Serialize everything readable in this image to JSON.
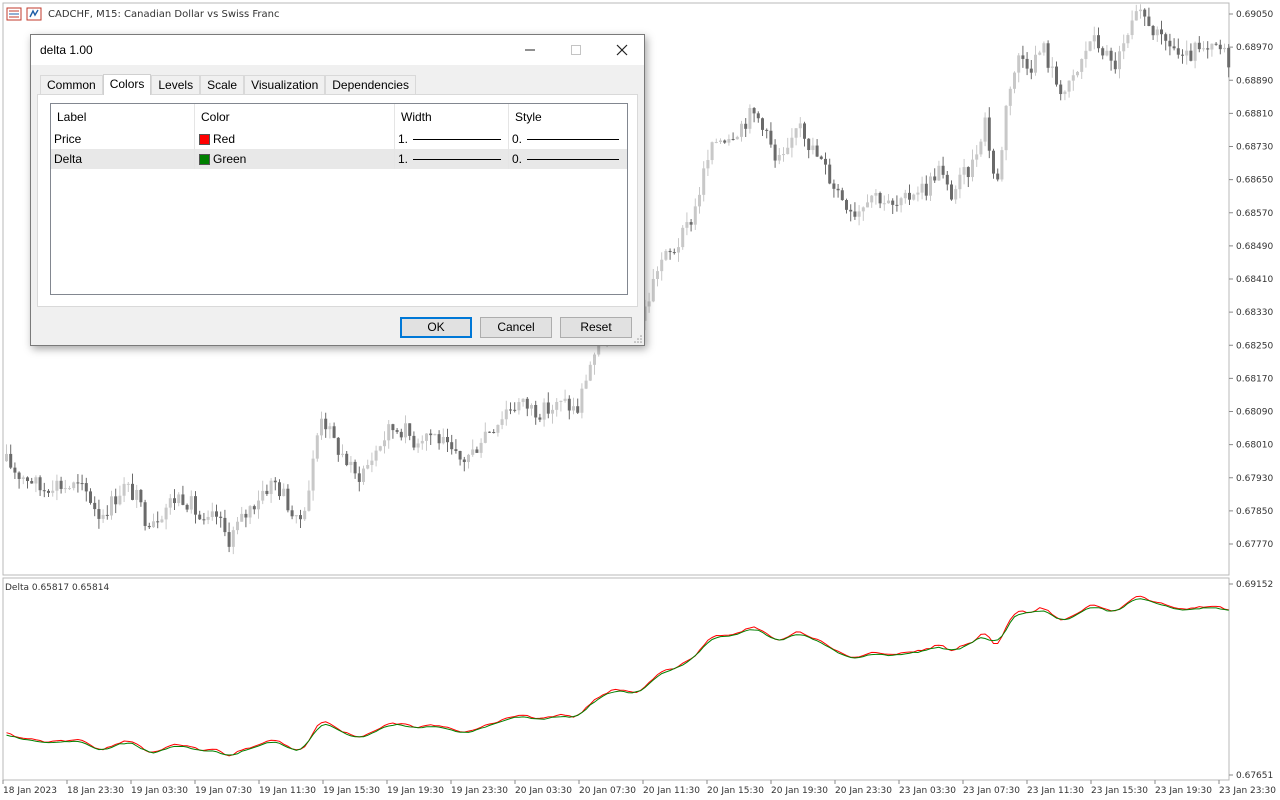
{
  "chart_window": {
    "symbol_caption": "CADCHF, M15:  Canadian Dollar vs Swiss Franc",
    "subwindow_caption": "Delta 0.65817 0.65814",
    "colors": {
      "bull": "#c8c8c8",
      "bear": "#6a6a6a",
      "price_line": "#ff0000",
      "delta_line": "#008000",
      "grid_border": "#b9b9b9"
    }
  },
  "dialog": {
    "title": "delta 1.00",
    "tabs": [
      "Common",
      "Colors",
      "Levels",
      "Scale",
      "Visualization",
      "Dependencies"
    ],
    "active_tab": "Colors",
    "grid": {
      "columns": [
        "Label",
        "Color",
        "Width",
        "Style"
      ],
      "rows": [
        {
          "label": "Price",
          "color_name": "Red",
          "color_hex": "#ff0000",
          "width": "1.",
          "style": "0."
        },
        {
          "label": "Delta",
          "color_name": "Green",
          "color_hex": "#008000",
          "width": "1.",
          "style": "0."
        }
      ]
    },
    "buttons": {
      "ok": "OK",
      "cancel": "Cancel",
      "reset": "Reset"
    }
  },
  "chart_data": [
    {
      "type": "candlestick",
      "title": "CADCHF, M15",
      "y_ticks": [
        "0.69050",
        "0.68970",
        "0.68890",
        "0.68810",
        "0.68730",
        "0.68650",
        "0.68570",
        "0.68490",
        "0.68410",
        "0.68330",
        "0.68250",
        "0.68170",
        "0.68090",
        "0.68010",
        "0.67930",
        "0.67850",
        "0.67770"
      ],
      "ylim": [
        0.6772,
        0.6908
      ],
      "x_ticks": [
        "18 Jan 2023",
        "18 Jan 23:30",
        "19 Jan 03:30",
        "19 Jan 07:30",
        "19 Jan 11:30",
        "19 Jan 15:30",
        "19 Jan 19:30",
        "19 Jan 23:30",
        "20 Jan 03:30",
        "20 Jan 07:30",
        "20 Jan 11:30",
        "20 Jan 15:30",
        "20 Jan 19:30",
        "20 Jan 23:30",
        "23 Jan 03:30",
        "23 Jan 07:30",
        "23 Jan 11:30",
        "23 Jan 15:30",
        "23 Jan 19:30",
        "23 Jan 23:30"
      ],
      "close_path": [
        [
          0,
          0.6797
        ],
        [
          1,
          0.6794
        ],
        [
          2,
          0.6793
        ],
        [
          3,
          0.679
        ],
        [
          4,
          0.6792
        ],
        [
          5,
          0.6791
        ],
        [
          6,
          0.6791
        ],
        [
          7,
          0.6789
        ],
        [
          8,
          0.6784
        ],
        [
          9,
          0.6787
        ],
        [
          10,
          0.6791
        ],
        [
          11,
          0.6789
        ],
        [
          12,
          0.6783
        ],
        [
          13,
          0.6784
        ],
        [
          14,
          0.6787
        ],
        [
          15,
          0.6789
        ],
        [
          16,
          0.6786
        ],
        [
          17,
          0.6781
        ],
        [
          18,
          0.6784
        ],
        [
          19,
          0.6778
        ],
        [
          20,
          0.6782
        ],
        [
          21,
          0.6786
        ],
        [
          22,
          0.679
        ],
        [
          23,
          0.6792
        ],
        [
          24,
          0.6788
        ],
        [
          25,
          0.6781
        ],
        [
          26,
          0.6791
        ],
        [
          27,
          0.6809
        ],
        [
          28,
          0.6802
        ],
        [
          29,
          0.6798
        ],
        [
          30,
          0.6793
        ],
        [
          31,
          0.6796
        ],
        [
          32,
          0.6801
        ],
        [
          33,
          0.6805
        ],
        [
          34,
          0.6805
        ],
        [
          35,
          0.6802
        ],
        [
          36,
          0.6804
        ],
        [
          37,
          0.6803
        ],
        [
          38,
          0.6799
        ],
        [
          39,
          0.6797
        ],
        [
          40,
          0.6799
        ],
        [
          41,
          0.6804
        ],
        [
          42,
          0.6806
        ],
        [
          43,
          0.681
        ],
        [
          44,
          0.6811
        ],
        [
          45,
          0.681
        ],
        [
          46,
          0.6809
        ],
        [
          47,
          0.681
        ],
        [
          48,
          0.6811
        ],
        [
          49,
          0.6809
        ],
        [
          50,
          0.682
        ],
        [
          51,
          0.6826
        ],
        [
          52,
          0.683
        ],
        [
          53,
          0.6831
        ],
        [
          54,
          0.6828
        ],
        [
          55,
          0.6835
        ],
        [
          56,
          0.6845
        ],
        [
          57,
          0.6847
        ],
        [
          58,
          0.6851
        ],
        [
          59,
          0.6857
        ],
        [
          60,
          0.6868
        ],
        [
          61,
          0.6875
        ],
        [
          62,
          0.6876
        ],
        [
          63,
          0.6878
        ],
        [
          64,
          0.6881
        ],
        [
          65,
          0.6879
        ],
        [
          66,
          0.6869
        ],
        [
          67,
          0.687
        ],
        [
          68,
          0.6881
        ],
        [
          69,
          0.6873
        ],
        [
          70,
          0.6869
        ],
        [
          71,
          0.6864
        ],
        [
          72,
          0.686
        ],
        [
          73,
          0.6857
        ],
        [
          74,
          0.6862
        ],
        [
          75,
          0.6861
        ],
        [
          76,
          0.6858
        ],
        [
          77,
          0.6859
        ],
        [
          78,
          0.6863
        ],
        [
          79,
          0.6863
        ],
        [
          80,
          0.6868
        ],
        [
          81,
          0.6861
        ],
        [
          82,
          0.6865
        ],
        [
          83,
          0.6869
        ],
        [
          84,
          0.688
        ],
        [
          85,
          0.6862
        ],
        [
          86,
          0.6887
        ],
        [
          87,
          0.6895
        ],
        [
          88,
          0.6893
        ],
        [
          89,
          0.6897
        ],
        [
          90,
          0.6889
        ],
        [
          91,
          0.6886
        ],
        [
          92,
          0.6891
        ],
        [
          93,
          0.6899
        ],
        [
          94,
          0.6897
        ],
        [
          95,
          0.6892
        ],
        [
          96,
          0.6897
        ],
        [
          97,
          0.6904
        ],
        [
          98,
          0.6904
        ],
        [
          99,
          0.6898
        ],
        [
          100,
          0.6898
        ],
        [
          101,
          0.6893
        ],
        [
          102,
          0.6896
        ],
        [
          103,
          0.6895
        ],
        [
          104,
          0.6897
        ],
        [
          105,
          0.6894
        ]
      ]
    },
    {
      "type": "line",
      "title": "Delta 0.65817 0.65814",
      "y_ticks": [
        "0.69152",
        "0.67651"
      ],
      "series": [
        {
          "name": "Price",
          "color": "#ff0000"
        },
        {
          "name": "Delta",
          "color": "#008000"
        }
      ]
    }
  ]
}
